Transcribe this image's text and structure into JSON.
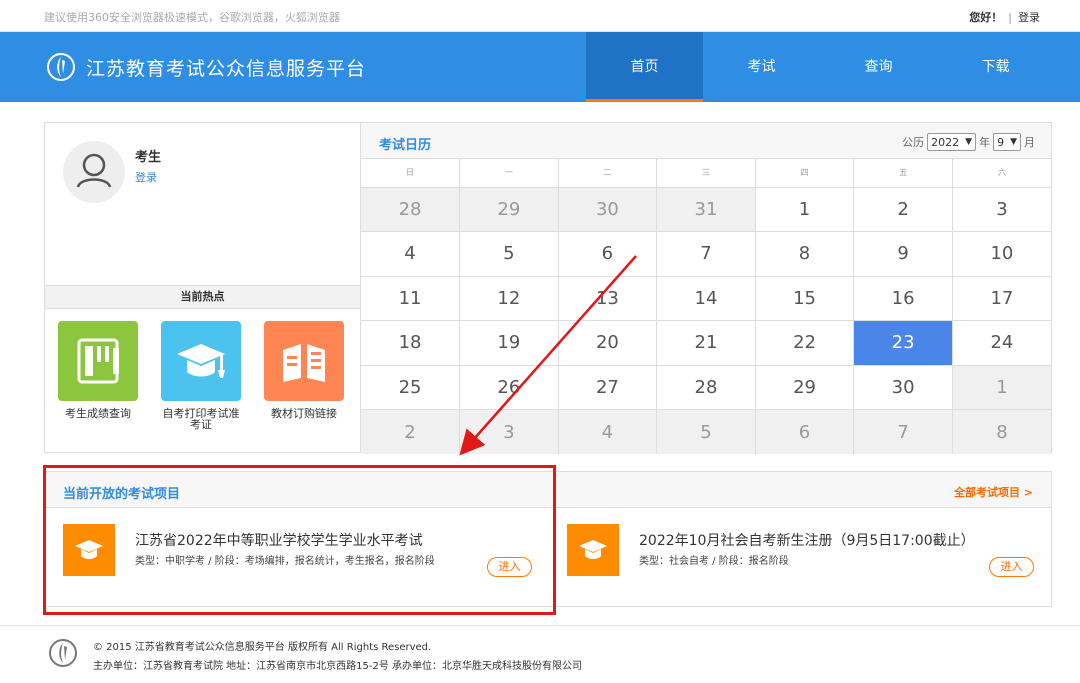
{
  "topbar": {
    "tip": "建议使用360安全浏览器极速模式，谷歌浏览器，火狐浏览器",
    "greeting": "您好！",
    "separator": "|",
    "login": "登录"
  },
  "header": {
    "title": "江苏教育考试公众信息服务平台",
    "nav": [
      "首页",
      "考试",
      "查询",
      "下载"
    ],
    "active_nav": "首页"
  },
  "user": {
    "name": "考生",
    "login_link": "登录"
  },
  "hot": {
    "title": "当前热点",
    "items": [
      {
        "label": "考生成绩查询",
        "color": "#8cc63f",
        "icon": "notebook-icon"
      },
      {
        "label": "自考打印考试准考证",
        "color": "#4cc3ee",
        "icon": "graduation-cap-icon"
      },
      {
        "label": "教材订购链接",
        "color": "#ff8552",
        "icon": "book-icon"
      }
    ]
  },
  "calendar": {
    "title": "考试日历",
    "prefix": "公历",
    "year": "2022",
    "year_unit": "年",
    "month": "9",
    "month_unit": "月",
    "weekdays": [
      "日",
      "一",
      "二",
      "三",
      "四",
      "五",
      "六"
    ],
    "weeks": [
      [
        "28",
        "29",
        "30",
        "31",
        "1",
        "2",
        "3"
      ],
      [
        "4",
        "5",
        "6",
        "7",
        "8",
        "9",
        "10"
      ],
      [
        "11",
        "12",
        "13",
        "14",
        "15",
        "16",
        "17"
      ],
      [
        "18",
        "19",
        "20",
        "21",
        "22",
        "23",
        "24"
      ],
      [
        "25",
        "26",
        "27",
        "28",
        "29",
        "30",
        "1"
      ],
      [
        "2",
        "3",
        "4",
        "5",
        "6",
        "7",
        "8"
      ]
    ],
    "today": "23"
  },
  "projects": {
    "title": "当前开放的考试项目",
    "all_link": "全部考试项目 >",
    "items": [
      {
        "title": "江苏省2022年中等职业学校学生学业水平考试",
        "meta": "类型：中职学考 / 阶段：考场编排，报名统计，考生报名，报名阶段",
        "enter": "进入"
      },
      {
        "title": "2022年10月社会自考新生注册（9月5日17:00截止）",
        "meta": "类型：社会自考 / 阶段：报名阶段",
        "enter": "进入"
      }
    ]
  },
  "footer": {
    "line1": "© 2015 江苏省教育考试公众信息服务平台 版权所有 All Rights Reserved.",
    "line2": "主办单位：江苏省教育考试院 地址：江苏省南京市北京西路15-2号 承办单位：北京华胜天成科技股份有限公司"
  },
  "colors": {
    "brand_blue": "#2f8de4",
    "accent_orange": "#ff7a00",
    "annotation_red": "#e01818",
    "today_blue": "#4a86e8"
  }
}
